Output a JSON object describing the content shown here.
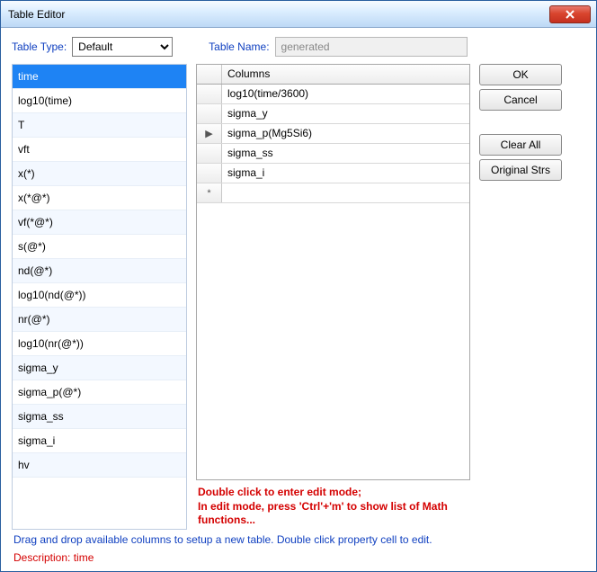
{
  "window": {
    "title": "Table Editor"
  },
  "top": {
    "table_type_label": "Table Type:",
    "table_type_value": "Default",
    "table_name_label": "Table Name:",
    "table_name_value": "generated"
  },
  "available": {
    "items": [
      "time",
      "log10(time)",
      "T",
      "vft",
      "x(*)",
      "x(*@*)",
      "vf(*@*)",
      "s(@*)",
      "nd(@*)",
      "log10(nd(@*))",
      "nr(@*)",
      "log10(nr(@*))",
      "sigma_y",
      "sigma_p(@*)",
      "sigma_ss",
      "sigma_i",
      "hv"
    ],
    "selected_index": 0
  },
  "columns": {
    "header": "Columns",
    "rows": [
      "log10(time/3600)",
      "sigma_y",
      "sigma_p(Mg5Si6)",
      "sigma_ss",
      "sigma_i"
    ],
    "current_row_index": 2
  },
  "buttons": {
    "ok": "OK",
    "cancel": "Cancel",
    "clear_all": "Clear All",
    "original_strs": "Original Strs"
  },
  "hints": {
    "edit": "Double click to enter edit mode;\nIn edit mode, press 'Ctrl'+'m' to show list of Math functions...",
    "drag": "Drag and drop available columns to setup a new table. Double click property cell to edit.",
    "description_label": "Description:",
    "description_value": "time"
  }
}
